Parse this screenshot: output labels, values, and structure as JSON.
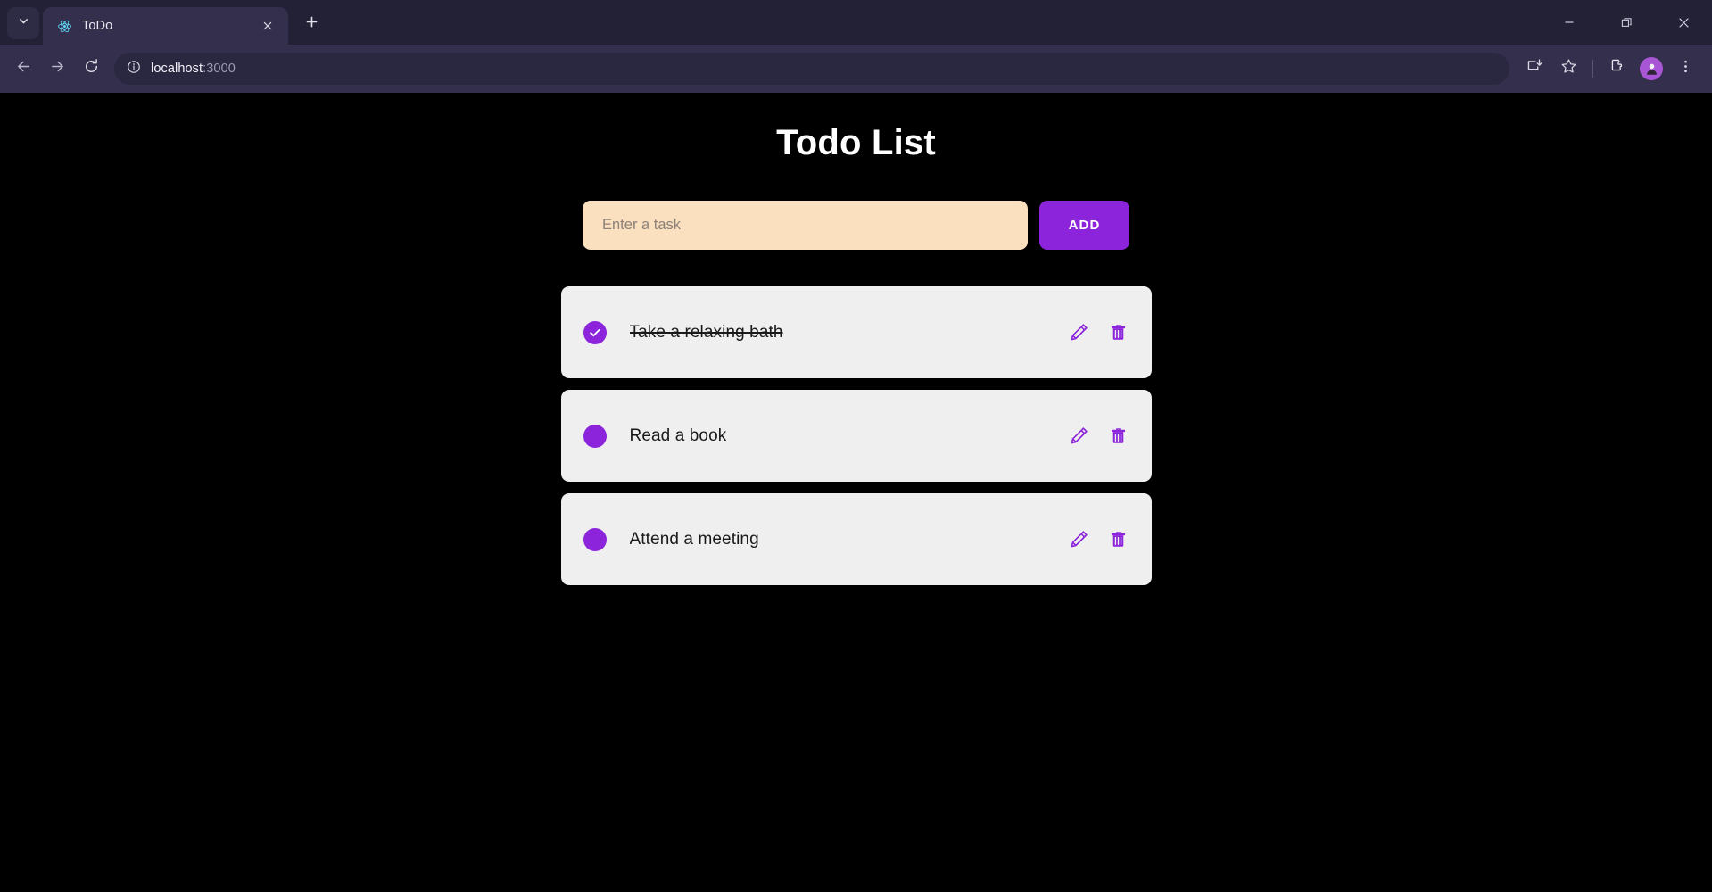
{
  "browser": {
    "tab_search_icon": "chevron-down-icon",
    "tab": {
      "title": "ToDo",
      "favicon": "react-logo-icon",
      "close_icon": "close-icon"
    },
    "new_tab_icon": "plus-icon",
    "window_controls": {
      "minimize": "minimize-icon",
      "maximize": "restore-icon",
      "close": "close-icon"
    },
    "nav": {
      "back_icon": "arrow-left-icon",
      "forward_icon": "arrow-right-icon",
      "reload_icon": "reload-icon"
    },
    "omnibox": {
      "info_icon": "info-circle-icon",
      "host": "localhost",
      "port": ":3000"
    },
    "toolbar_icons": [
      {
        "name": "install-app-icon"
      },
      {
        "name": "bookmark-star-icon"
      },
      {
        "name": "extensions-puzzle-icon"
      },
      {
        "name": "profile-avatar-icon"
      },
      {
        "name": "more-vertical-icon"
      }
    ]
  },
  "page": {
    "title": "Todo List",
    "input": {
      "value": "",
      "placeholder": "Enter a task"
    },
    "add_button": "ADD",
    "todos": [
      {
        "text": "Take a relaxing bath",
        "completed": true,
        "bullet_icon": "check-circle-icon",
        "edit_icon": "pencil-icon",
        "delete_icon": "trash-icon"
      },
      {
        "text": "Read a book",
        "completed": false,
        "bullet_icon": "circle-icon",
        "edit_icon": "pencil-icon",
        "delete_icon": "trash-icon"
      },
      {
        "text": "Attend a meeting",
        "completed": false,
        "bullet_icon": "circle-icon",
        "edit_icon": "pencil-icon",
        "delete_icon": "trash-icon"
      }
    ]
  },
  "colors": {
    "accent_purple": "#8c24db",
    "input_peach": "#fbe0c0",
    "card_gray": "#efefef",
    "page_bg": "#000000",
    "chrome_bg": "#342f4d"
  }
}
